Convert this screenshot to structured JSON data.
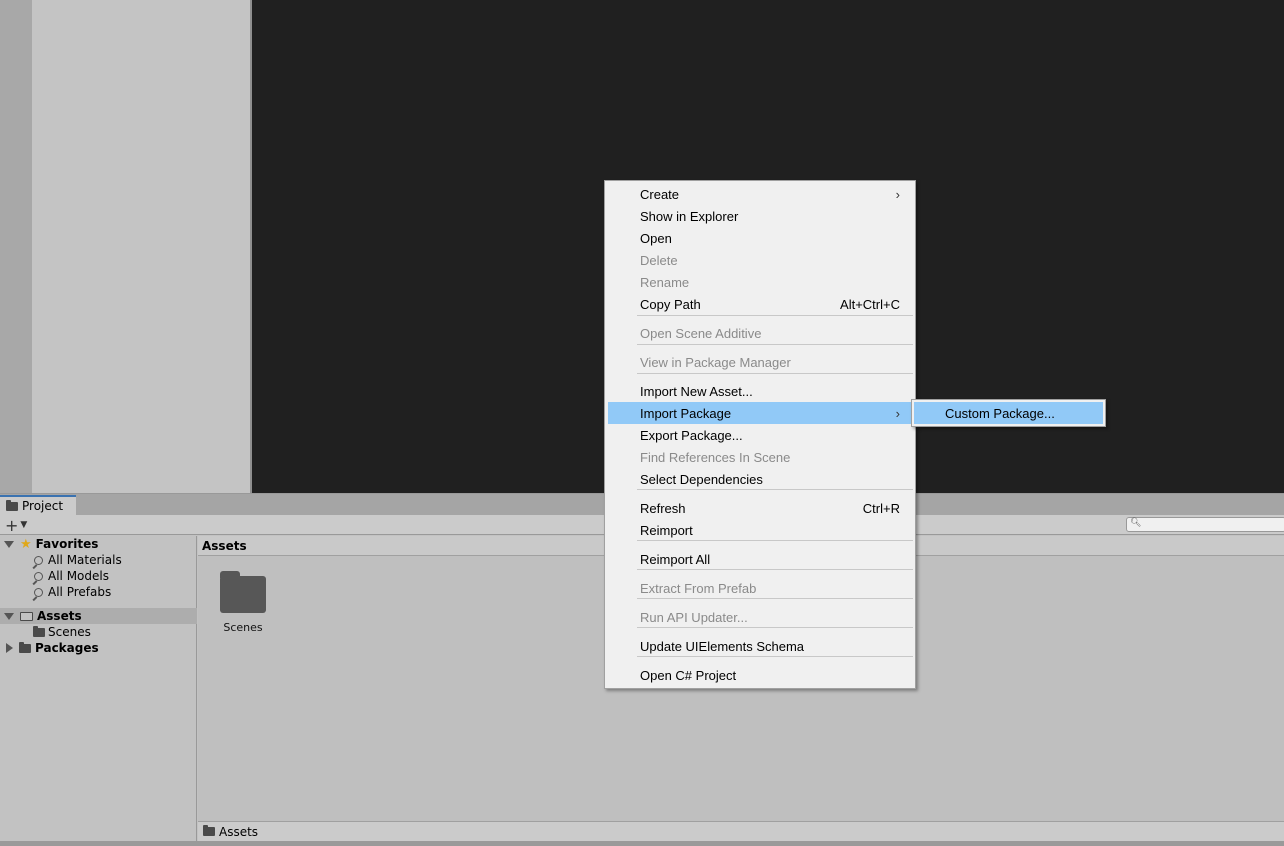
{
  "project_window": {
    "tab_label": "Project",
    "content_header": "Assets",
    "status_path": "Assets",
    "search": {
      "placeholder": ""
    }
  },
  "tree": {
    "favorites_label": "Favorites",
    "favorites": [
      "All Materials",
      "All Models",
      "All Prefabs"
    ],
    "assets_label": "Assets",
    "assets_children": [
      "Scenes"
    ],
    "packages_label": "Packages"
  },
  "assets_grid": [
    {
      "name": "Scenes",
      "icon": "folder-icon"
    }
  ],
  "context_menu": {
    "items": [
      {
        "label": "Create",
        "shortcut": "",
        "submenu": true,
        "disabled": false
      },
      {
        "label": "Show in Explorer",
        "shortcut": "",
        "submenu": false,
        "disabled": false
      },
      {
        "label": "Open",
        "shortcut": "",
        "submenu": false,
        "disabled": false
      },
      {
        "label": "Delete",
        "shortcut": "",
        "submenu": false,
        "disabled": true
      },
      {
        "label": "Rename",
        "shortcut": "",
        "submenu": false,
        "disabled": true
      },
      {
        "label": "Copy Path",
        "shortcut": "Alt+Ctrl+C",
        "submenu": false,
        "disabled": false
      },
      {
        "label": "Open Scene Additive",
        "shortcut": "",
        "submenu": false,
        "disabled": true
      },
      {
        "label": "View in Package Manager",
        "shortcut": "",
        "submenu": false,
        "disabled": true
      },
      {
        "label": "Import New Asset...",
        "shortcut": "",
        "submenu": false,
        "disabled": false
      },
      {
        "label": "Import Package",
        "shortcut": "",
        "submenu": true,
        "disabled": false,
        "highlighted": true
      },
      {
        "label": "Export Package...",
        "shortcut": "",
        "submenu": false,
        "disabled": false
      },
      {
        "label": "Find References In Scene",
        "shortcut": "",
        "submenu": false,
        "disabled": true
      },
      {
        "label": "Select Dependencies",
        "shortcut": "",
        "submenu": false,
        "disabled": false
      },
      {
        "label": "Refresh",
        "shortcut": "Ctrl+R",
        "submenu": false,
        "disabled": false
      },
      {
        "label": "Reimport",
        "shortcut": "",
        "submenu": false,
        "disabled": false
      },
      {
        "label": "Reimport All",
        "shortcut": "",
        "submenu": false,
        "disabled": false
      },
      {
        "label": "Extract From Prefab",
        "shortcut": "",
        "submenu": false,
        "disabled": true
      },
      {
        "label": "Run API Updater...",
        "shortcut": "",
        "submenu": false,
        "disabled": true
      },
      {
        "label": "Update UIElements Schema",
        "shortcut": "",
        "submenu": false,
        "disabled": false
      },
      {
        "label": "Open C# Project",
        "shortcut": "",
        "submenu": false,
        "disabled": false
      }
    ],
    "submenu_arrow": "›"
  },
  "import_package_submenu": {
    "items": [
      {
        "label": "Custom Package...",
        "highlighted": true
      }
    ]
  },
  "colors": {
    "menu_highlight": "#91c9f7",
    "scene_background": "#202020",
    "favorites_star": "#e0a81a"
  }
}
